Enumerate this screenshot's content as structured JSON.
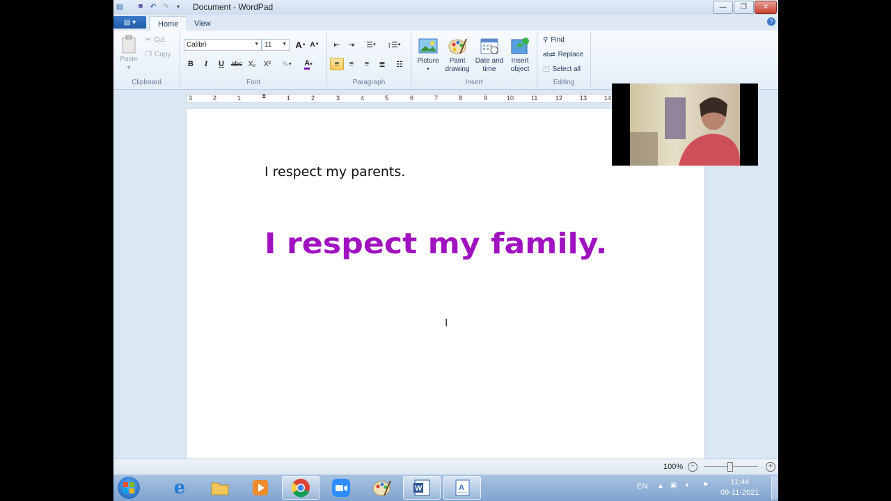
{
  "window": {
    "title": "Document - WordPad",
    "minimize": "—",
    "restore": "❐",
    "close": "✕"
  },
  "tabs": [
    {
      "label": "Home"
    },
    {
      "label": "View"
    }
  ],
  "help_label": "?",
  "clipboard": {
    "paste": "Paste",
    "cut": "Cut",
    "copy": "Copy",
    "group_label": "Clipboard"
  },
  "font": {
    "family": "Calibri",
    "size": "11",
    "bold": "B",
    "italic": "I",
    "underline": "U",
    "strike": "abc",
    "subscript": "X₂",
    "superscript": "X²",
    "grow": "A",
    "shrink": "A",
    "color_letter": "A",
    "group_label": "Font"
  },
  "paragraph": {
    "group_label": "Paragraph"
  },
  "insert": {
    "picture": "Picture",
    "paint_drawing": [
      "Paint",
      "drawing"
    ],
    "date_time": [
      "Date and",
      "time"
    ],
    "insert_object": [
      "Insert",
      "object"
    ],
    "group_label": "Insert"
  },
  "editing": {
    "find": "Find",
    "replace": "Replace",
    "select_all": "Select all",
    "group_label": "Editing"
  },
  "ruler": [
    "3",
    "2",
    "1",
    "1",
    "2",
    "3",
    "4",
    "5",
    "6",
    "7",
    "8",
    "9",
    "10",
    "11",
    "12",
    "13",
    "14"
  ],
  "document": {
    "line1": "I respect my parents.",
    "line2": "I respect my family.",
    "line2_color": "#a012c0"
  },
  "status": {
    "zoom": "100%"
  },
  "taskbar": {
    "language": "EN",
    "time": "11:44",
    "date": "09-11-2021"
  }
}
